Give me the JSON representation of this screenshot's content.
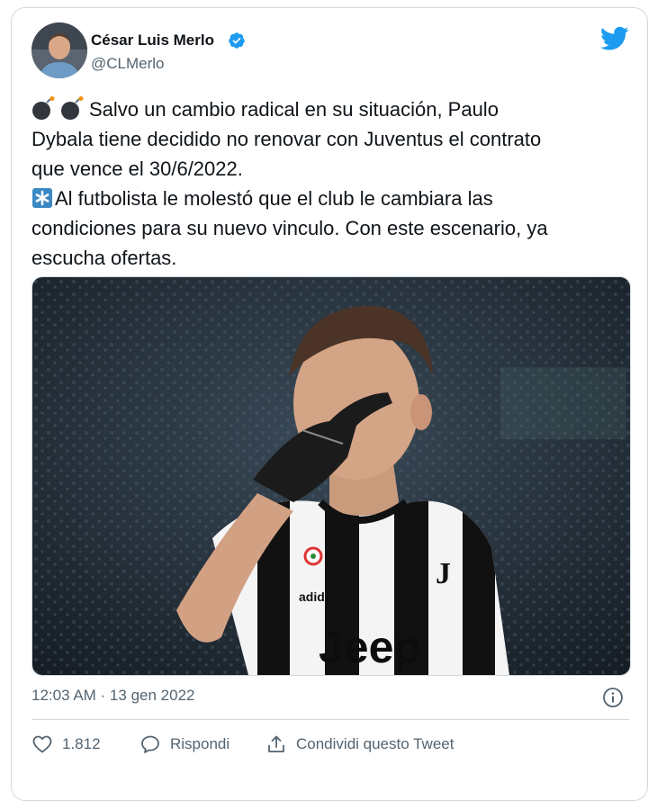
{
  "author": {
    "name": "César Luis Merlo",
    "handle": "@CLMerlo",
    "verified": true
  },
  "tweet": {
    "lines": [
      "Salvo un cambio radical en su situación, Paulo",
      "Dybala tiene decidido no renovar con Juventus el contrato",
      "que vence el 30/6/2022.",
      "Al futbolista le molestó que el club le cambiara las",
      "condiciones para su nuevo vinculo. Con este escenario, ya",
      "escucha ofertas."
    ],
    "media": {
      "jersey_sponsor": "Jeep",
      "jersey_brand": "adidas"
    }
  },
  "meta": {
    "timestamp": "12:03 AM · 13 gen 2022"
  },
  "actions": {
    "like_count": "1.812",
    "reply_label": "Rispondi",
    "share_label": "Condividi questo Tweet"
  },
  "colors": {
    "twitter_blue": "#1d9bf0",
    "text_primary": "#0f1419",
    "text_secondary": "#536471",
    "border": "#cfd9de"
  },
  "icons": [
    "bomb-icon",
    "asterisk-icon",
    "verified-badge-icon",
    "twitter-bird-icon",
    "info-icon",
    "heart-icon",
    "reply-icon",
    "share-icon"
  ]
}
